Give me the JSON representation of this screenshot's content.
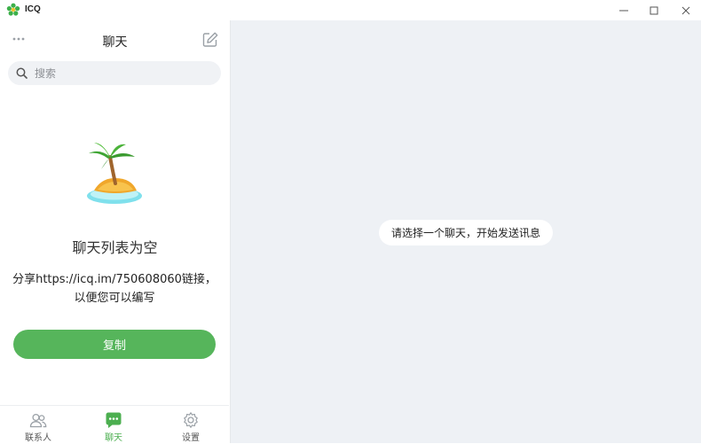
{
  "window": {
    "title": "ICQ",
    "minimize_icon": "minimize-icon",
    "maximize_icon": "maximize-icon",
    "close_icon": "close-icon"
  },
  "left_panel": {
    "title": "聊天",
    "search": {
      "placeholder": "搜索",
      "value": ""
    },
    "empty_state": {
      "title": "聊天列表为空",
      "share_text": "分享https://icq.im/750608060链接，以便您可以编写",
      "copy_button": "复制"
    },
    "bottom_nav": [
      {
        "label": "联系人",
        "icon": "contacts-icon",
        "active": false
      },
      {
        "label": "聊天",
        "icon": "chat-bubble-icon",
        "active": true
      },
      {
        "label": "设置",
        "icon": "gear-icon",
        "active": false
      }
    ]
  },
  "main": {
    "hint": "请选择一个聊天，开始发送讯息"
  },
  "colors": {
    "accent": "#56b55b",
    "main_bg": "#eef1f5",
    "search_bg": "#f0f2f5"
  }
}
